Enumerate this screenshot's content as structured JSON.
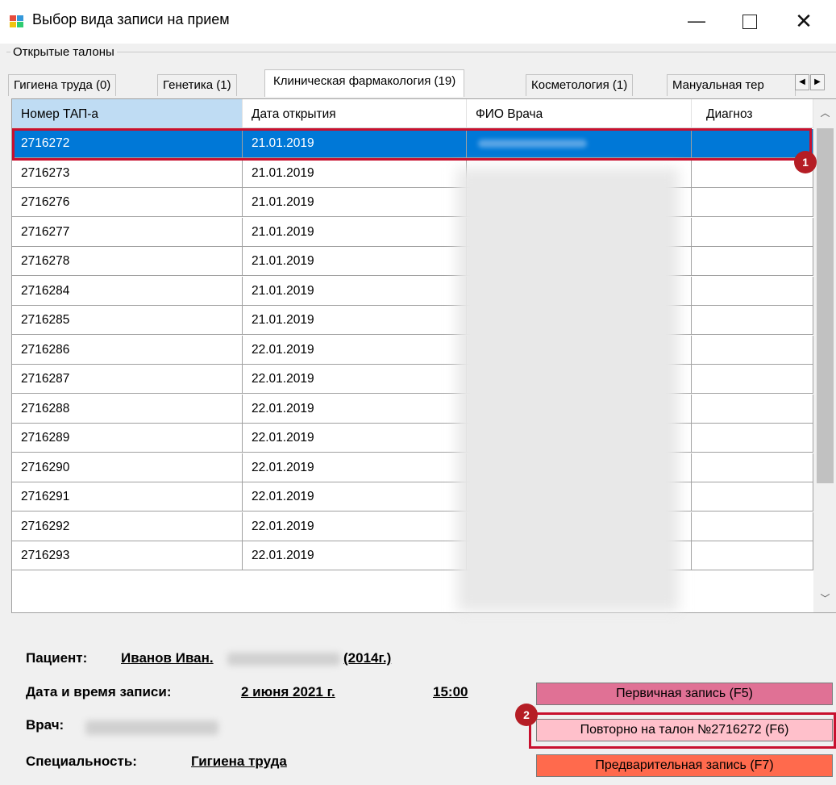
{
  "window": {
    "title": "Выбор вида записи на прием",
    "minimize_symbol": "—",
    "close_symbol": "✕"
  },
  "group": {
    "label": "Открытые талоны"
  },
  "tabs": [
    {
      "label": "Гигиена труда (0)"
    },
    {
      "label": "Генетика (1)"
    },
    {
      "label": "Клиническая фармакология (19)",
      "active": true
    },
    {
      "label": "Косметология (1)"
    },
    {
      "label": "Мануальная тер"
    }
  ],
  "table": {
    "columns": [
      "Номер ТАП-а",
      "Дата открытия",
      "ФИО Врача",
      "Диагноз"
    ],
    "rows": [
      {
        "number": "2716272",
        "date": "21.01.2019",
        "doctor": "",
        "diagnosis": ""
      },
      {
        "number": "2716273",
        "date": "21.01.2019",
        "doctor": "",
        "diagnosis": ""
      },
      {
        "number": "2716276",
        "date": "21.01.2019",
        "doctor": "",
        "diagnosis": ""
      },
      {
        "number": "2716277",
        "date": "21.01.2019",
        "doctor": "",
        "diagnosis": ""
      },
      {
        "number": "2716278",
        "date": "21.01.2019",
        "doctor": "",
        "diagnosis": ""
      },
      {
        "number": "2716284",
        "date": "21.01.2019",
        "doctor": "",
        "diagnosis": ""
      },
      {
        "number": "2716285",
        "date": "21.01.2019",
        "doctor": "",
        "diagnosis": ""
      },
      {
        "number": "2716286",
        "date": "22.01.2019",
        "doctor": "",
        "diagnosis": ""
      },
      {
        "number": "2716287",
        "date": "22.01.2019",
        "doctor": "",
        "diagnosis": ""
      },
      {
        "number": "2716288",
        "date": "22.01.2019",
        "doctor": "",
        "diagnosis": ""
      },
      {
        "number": "2716289",
        "date": "22.01.2019",
        "doctor": "",
        "diagnosis": ""
      },
      {
        "number": "2716290",
        "date": "22.01.2019",
        "doctor": "",
        "diagnosis": ""
      },
      {
        "number": "2716291",
        "date": "22.01.2019",
        "doctor": "",
        "diagnosis": ""
      },
      {
        "number": "2716292",
        "date": "22.01.2019",
        "doctor": "",
        "diagnosis": ""
      },
      {
        "number": "2716293",
        "date": "22.01.2019",
        "doctor": "",
        "diagnosis": ""
      }
    ],
    "selected_row": 0
  },
  "info": {
    "patient_label": "Пациент:",
    "patient_name": "Иванов Иван.",
    "patient_year": "(2014г.)",
    "datetime_label": "Дата и время записи:",
    "date": "2 июня 2021 г.",
    "time": "15:00",
    "doctor_label": "Врач:",
    "specialty_label": "Специальность:",
    "specialty": "Гигиена труда"
  },
  "buttons": {
    "primary": "Первичная запись (F5)",
    "repeat": "Повторно на талон №2716272 (F6)",
    "pre": "Предварительная запись (F7)"
  },
  "markers": {
    "m1": "1",
    "m2": "2"
  },
  "colors": {
    "selection": "#0078d7",
    "highlight": "#c8102e",
    "primary_button": "#e07195",
    "repeat_button": "#ffc0cb",
    "pre_button": "#ff6a4d"
  }
}
